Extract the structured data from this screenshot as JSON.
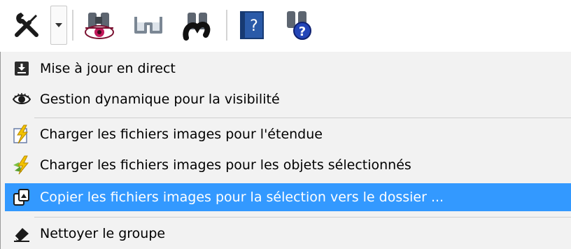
{
  "toolbar": {
    "buttons": [
      {
        "icon": "tools-icon"
      },
      {
        "icon": "chevron-down-icon"
      },
      {
        "icon": "binoculars-eye-icon"
      },
      {
        "icon": "glasses-icon"
      },
      {
        "icon": "binoculars-magnet-icon"
      },
      {
        "icon": "help-book-icon",
        "glyph": "?"
      },
      {
        "icon": "binoculars-help-icon",
        "glyph": "?"
      }
    ]
  },
  "menu": {
    "items": [
      {
        "label": "Mise à jour en direct",
        "icon": "download-icon"
      },
      {
        "label": "Gestion dynamique pour la visibilité",
        "icon": "eye-icon"
      },
      {
        "label": "Charger les fichiers images pour l'étendue",
        "icon": "lightning-icon"
      },
      {
        "label": "Charger les fichiers images pour les objets sélectionnés",
        "icon": "lightning-selection-icon"
      },
      {
        "label": "Copier les fichiers images pour la sélection vers le dossier ...",
        "icon": "copy-images-icon",
        "highlighted": true
      },
      {
        "label": "Nettoyer le groupe",
        "icon": "eraser-icon"
      }
    ]
  },
  "colors": {
    "highlight": "#3399ff",
    "menu_bg": "#f2f2f2",
    "help_blue": "#1f4fa8"
  }
}
